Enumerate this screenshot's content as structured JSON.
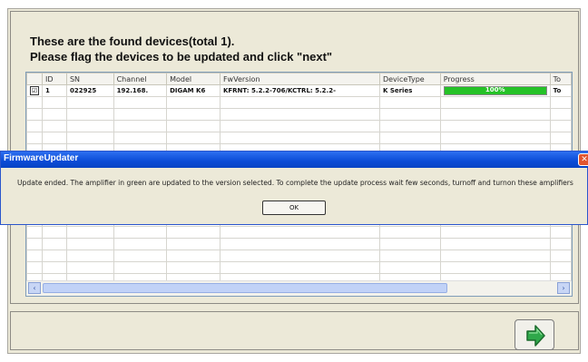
{
  "heading": {
    "line1": "These are the found devices(total 1).",
    "line2": "Please flag the devices to be updated and click \"next\""
  },
  "table": {
    "columns": [
      "ID",
      "SN",
      "Channel",
      "Model",
      "FwVersion",
      "DeviceType",
      "Progress",
      "To"
    ],
    "rows": [
      {
        "checked": "☑",
        "id": "1",
        "sn": "022925",
        "channel": "192.168.",
        "model": "DIGAM K6",
        "fw": "KFRNT: 5.2.2-706/KCTRL: 5.2.2-",
        "type": "K Series",
        "progress_text": "100%",
        "progress_value": 1.0,
        "to": "To"
      }
    ]
  },
  "scrollbar": {
    "left_arrow": "‹",
    "right_arrow": "›"
  },
  "dialog": {
    "title": "FirmwareUpdater",
    "message": "Update ended. The amplifier in green are updated to the version selected. To complete the update process wait few seconds, turnoff and turnon these amplifiers",
    "ok_label": "OK",
    "close_glyph": "✕"
  },
  "colors": {
    "progress_fill": "#25c227",
    "titlebar": "#0a4bd6",
    "next_arrow": "#2fa84a"
  },
  "icons": {
    "next": "arrow-right-icon"
  }
}
